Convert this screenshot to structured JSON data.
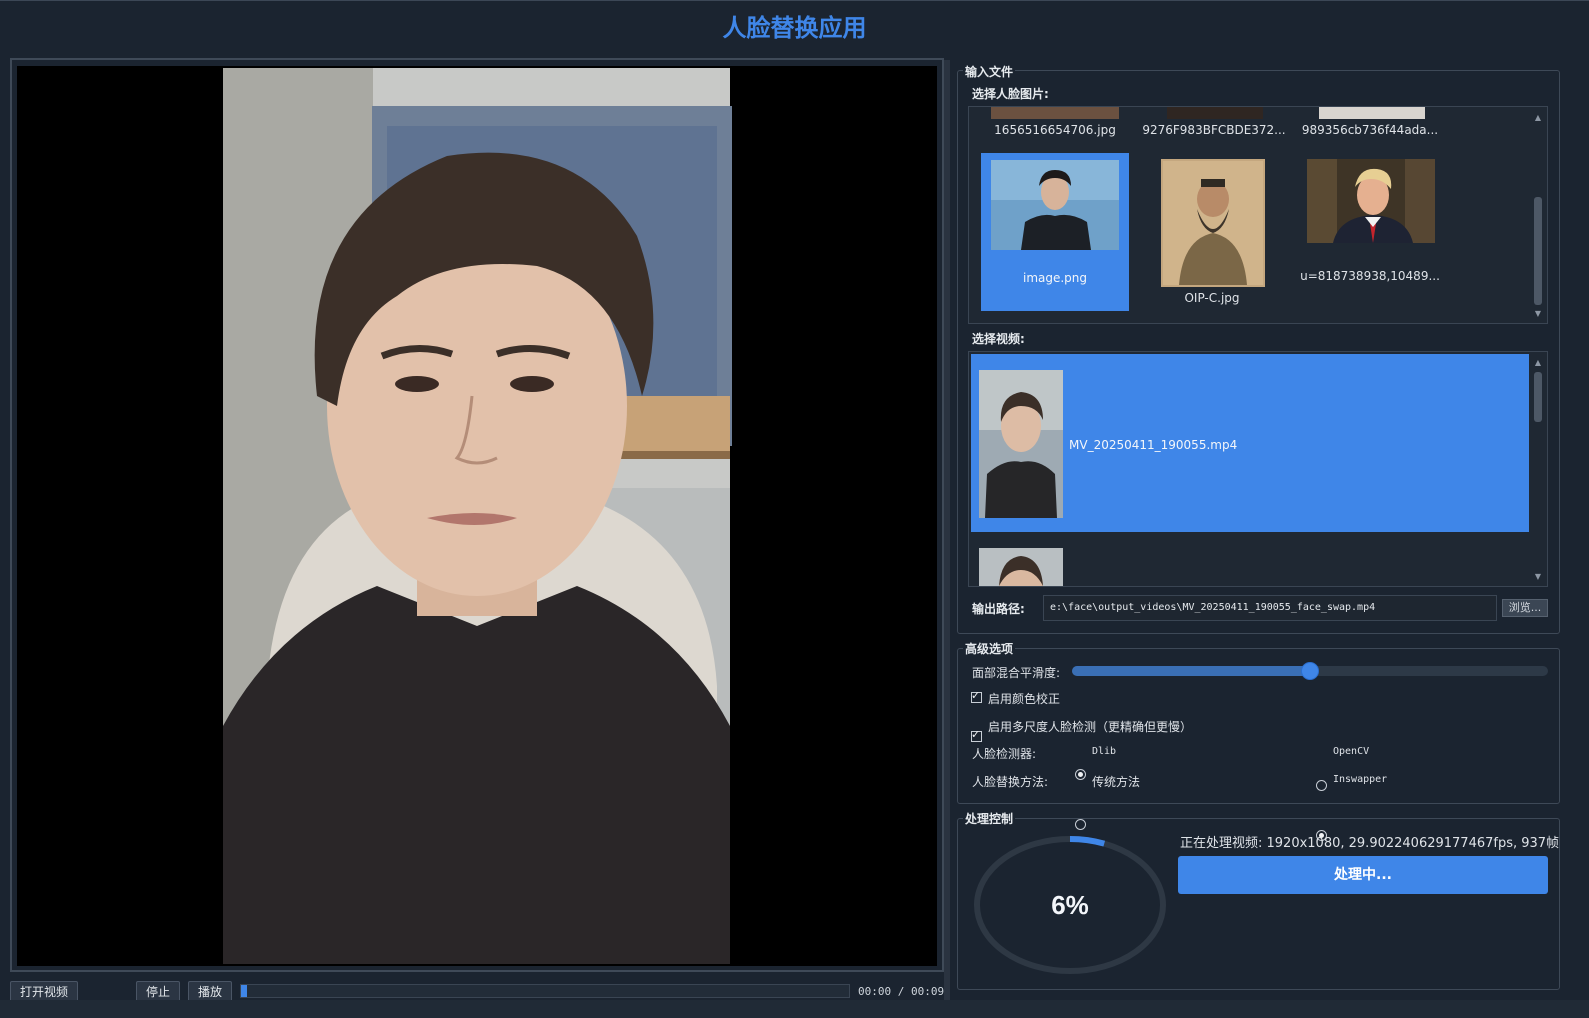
{
  "app": {
    "title": "人脸替换应用"
  },
  "player": {
    "open_video_label": "打开视频",
    "stop_label": "停止",
    "play_label": "播放",
    "time": "00:00 / 00:09",
    "progress_fraction": 0.01
  },
  "input_group": {
    "title": "输入文件",
    "face_label": "选择人脸图片:",
    "face_images": [
      {
        "name": "1656516654706.jpg",
        "selected": false
      },
      {
        "name": "9276F983BFCBDE372...",
        "selected": false
      },
      {
        "name": "989356cb736f44ada...",
        "selected": false
      },
      {
        "name": "image.png",
        "selected": true
      },
      {
        "name": "OIP-C.jpg",
        "selected": false
      },
      {
        "name": "u=818738938,10489...",
        "selected": false
      }
    ],
    "video_label": "选择视频:",
    "videos": [
      {
        "name": "MV_20250411_190055.mp4",
        "selected": true
      },
      {
        "name": "",
        "selected": false
      }
    ],
    "output_label": "输出路径:",
    "output_path": "e:\\face\\output_videos\\MV_20250411_190055_face_swap.mp4",
    "browse_label": "浏览..."
  },
  "advanced_group": {
    "title": "高级选项",
    "blend_label": "面部混合平滑度:",
    "blend_value_fraction": 0.5,
    "color_correction_label": "启用颜色校正",
    "color_correction_checked": true,
    "multiscale_label": "启用多尺度人脸检测（更精确但更慢）",
    "multiscale_checked": true,
    "detector_label": "人脸检测器:",
    "detector_options": [
      "Dlib",
      "OpenCV"
    ],
    "detector_selected": "Dlib",
    "swap_method_label": "人脸替换方法:",
    "swap_method_options": [
      "传统方法",
      "Inswapper"
    ],
    "swap_method_selected": "Inswapper"
  },
  "process_group": {
    "title": "处理控制",
    "progress_percent": 6,
    "progress_text": "6%",
    "status_text": "正在处理视频: 1920x1080, 29.902240629177467fps, 937帧",
    "process_button_label": "处理中..."
  },
  "colors": {
    "accent": "#3f86e8",
    "background": "#1b2430",
    "panel_border": "#3e4957"
  }
}
